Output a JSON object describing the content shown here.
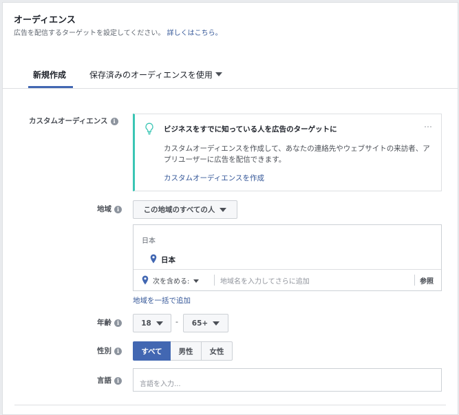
{
  "header": {
    "title": "オーディエンス",
    "subtitle": "広告を配信するターゲットを設定してください。",
    "subtitle_link": "詳しくはこちら。"
  },
  "tabs": [
    {
      "label": "新規作成",
      "active": true
    },
    {
      "label": "保存済みのオーディエンスを使用",
      "active": false
    }
  ],
  "custom_audience": {
    "label": "カスタムオーディエンス",
    "card_title": "ビジネスをすでに知っている人を広告のターゲットに",
    "card_description": "カスタムオーディエンスを作成して、あなたの連絡先やウェブサイトの来訪者、アプリユーザーに広告を配信できます。",
    "card_link": "カスタムオーディエンスを作成",
    "more_icon": "…",
    "accent_color": "#3ac5b4"
  },
  "location": {
    "label": "地域",
    "scope_select": "この地域のすべての人",
    "group_heading": "日本",
    "selected_item": "日本",
    "include_select": "次を含める:",
    "input_placeholder": "地域名を入力してさらに追加",
    "browse_label": "参照",
    "bulk_link": "地域を一括で追加"
  },
  "age": {
    "label": "年齢",
    "min": "18",
    "separator": "-",
    "max": "65+"
  },
  "gender": {
    "label": "性別",
    "options": [
      "すべて",
      "男性",
      "女性"
    ],
    "selected": "すべて",
    "active_color": "#4267b2"
  },
  "language": {
    "label": "言語",
    "placeholder": "言語を入力..."
  },
  "info_icon": "i"
}
